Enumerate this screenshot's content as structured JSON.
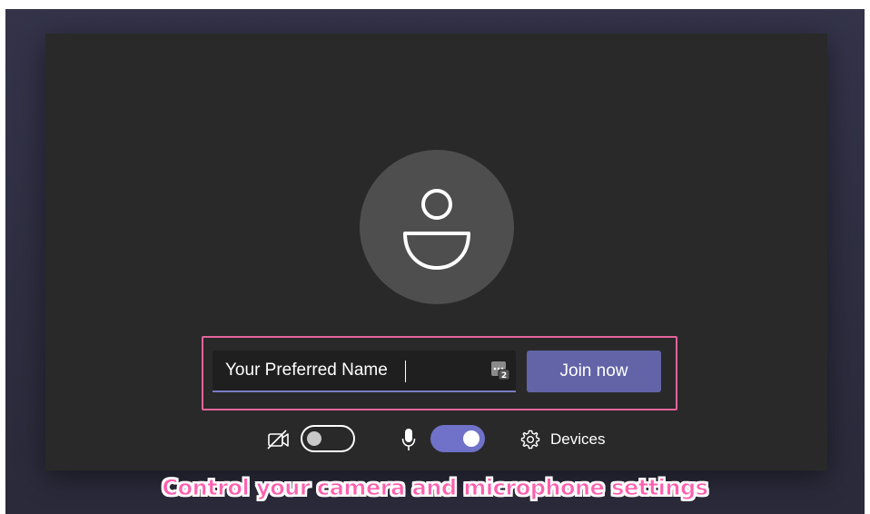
{
  "name_field": {
    "value": "Your Preferred Name",
    "badge_icon": "keyboard-badge-icon"
  },
  "join_button": {
    "label": "Join now"
  },
  "controls": {
    "camera": {
      "icon": "camera-off-icon",
      "state": "off"
    },
    "microphone": {
      "icon": "microphone-icon",
      "state": "on"
    },
    "devices": {
      "icon": "gear-icon",
      "label": "Devices"
    }
  },
  "caption": "Control your camera and microphone settings",
  "colors": {
    "accent": "#6264a7",
    "highlight_border": "#e4639b",
    "caption_text": "#ff5fae",
    "panel_bg": "#292929",
    "avatar_bg": "#4e4e4e"
  }
}
